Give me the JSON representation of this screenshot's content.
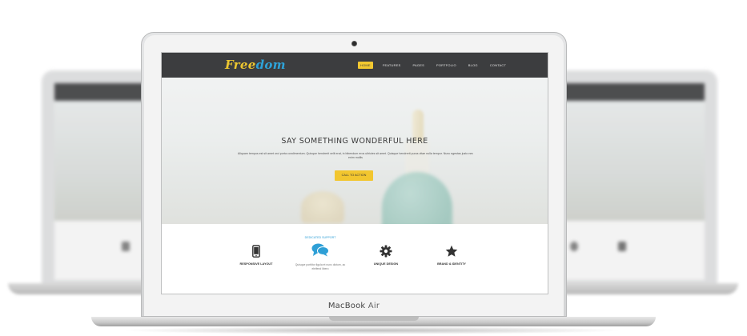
{
  "device": {
    "brand": "MacBook",
    "model": "Air"
  },
  "site": {
    "logo": {
      "part1": "Free",
      "part2": "dom"
    },
    "menu": [
      {
        "label": "HOME",
        "active": true
      },
      {
        "label": "FEATURES",
        "active": false
      },
      {
        "label": "PAGES",
        "active": false
      },
      {
        "label": "PORTFOLIO",
        "active": false
      },
      {
        "label": "BLOG",
        "active": false
      },
      {
        "label": "CONTACT",
        "active": false
      }
    ],
    "hero": {
      "title": "SAY SOMETHING WONDERFUL HERE",
      "text": "Aliquam tempus est sit amet orci porta condimentum. Quisque hendrerit velit erat, in bibendum eros ultricies sit amet. Quisque hendrerit purus vitae nulla tempor. Nunc egestas justo nec enim mollis",
      "cta": "CALL TO ACTION"
    },
    "features": [
      {
        "icon": "mobile-phone-icon",
        "tag": "",
        "label": "RESPONSIVE LAYOUT",
        "sub": ""
      },
      {
        "icon": "chat-bubbles-icon",
        "tag": "DEDICATED SUPPORT",
        "label": "",
        "sub": "Quisque porttitor ligula et nunc dictum, ac eleifend libero"
      },
      {
        "icon": "gear-icon",
        "tag": "",
        "label": "UNIQUE DESIGN",
        "sub": ""
      },
      {
        "icon": "star-icon",
        "tag": "",
        "label": "BRAND & IDENTITY",
        "sub": ""
      }
    ]
  },
  "colors": {
    "accent_yellow": "#f2c62f",
    "accent_blue": "#2ea3d9",
    "nav_dark": "#3c3d3f"
  }
}
